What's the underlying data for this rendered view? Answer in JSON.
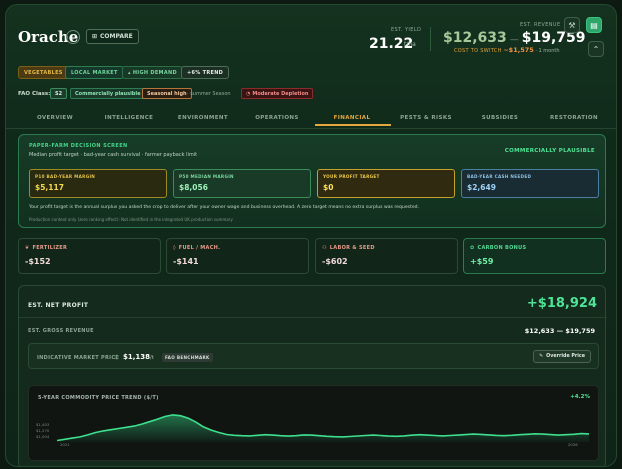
{
  "crop": {
    "name": "Orache",
    "compare_label": "COMPARE"
  },
  "header": {
    "yield_label": "EST. YIELD",
    "yield_value": "21.22",
    "yield_unit": "t/ha",
    "revenue_label": "EST. REVENUE",
    "revenue_low": "$12,633",
    "revenue_sep": "—",
    "revenue_high": "$19,759",
    "cost_label": "COST TO SWITCH",
    "cost_value": "~$1,575",
    "cost_suffix": "· 1 month"
  },
  "tags": [
    "VEGETABLES",
    "LOCAL MARKET",
    "HIGH DEMAND",
    "+6% TREND"
  ],
  "fao": {
    "label": "FAO Class:",
    "class_code": "S2",
    "class_name": "Commercially plausible",
    "seasonal": "Seasonal high",
    "season_note": "summer Season",
    "depletion": "Moderate Depletion"
  },
  "tabs": [
    "OVERVIEW",
    "INTELLIGENCE",
    "ENVIRONMENT",
    "OPERATIONS",
    "FINANCIAL",
    "PESTS & RISKS",
    "SUBSIDIES",
    "RESTORATION"
  ],
  "active_tab": "FINANCIAL",
  "screen": {
    "title": "PAPER-FARM DECISION SCREEN",
    "subtitle": "Median profit target · bad-year cash survival · farmer payback limit",
    "status": "COMMERCIALLY PLAUSIBLE",
    "metrics": [
      {
        "label": "P10 BAD-YEAR MARGIN",
        "value": "$5,117"
      },
      {
        "label": "P50 MEDIAN MARGIN",
        "value": "$8,056"
      },
      {
        "label": "YOUR PROFIT TARGET",
        "value": "$0"
      },
      {
        "label": "BAD-YEAR CASH NEEDED",
        "value": "$2,649"
      }
    ],
    "description": "Your profit target is the annual surplus you asked the crop to deliver after your owner wage and business overhead. A zero target means no extra surplus was requested.",
    "footnote": "Production context only (zero ranking effect): Not identified in the integrated UK production summary"
  },
  "costs": [
    {
      "label": "FERTILIZER",
      "value": "-$152",
      "icon": "leaf-icon"
    },
    {
      "label": "FUEL / MACH.",
      "value": "-$141",
      "icon": "fuel-icon"
    },
    {
      "label": "LABOR & SEED",
      "value": "-$602",
      "icon": "people-icon"
    },
    {
      "label": "CARBON BONUS",
      "value": "+$59",
      "icon": "carbon-icon"
    }
  ],
  "profit": {
    "net_label": "EST. NET PROFIT",
    "net_value": "+$18,924",
    "gross_label": "EST. GROSS REVENUE",
    "gross_value": "$12,633 — $19,759",
    "market_label": "INDICATIVE MARKET PRICE",
    "market_value": "$1,138",
    "market_unit": "/t",
    "benchmark": "FAO BENCHMARK",
    "override_label": "Override Price"
  },
  "trend": {
    "title": "5-YEAR COMMODITY PRICE TREND ($/T)",
    "change": "+4.2%",
    "y_ticks": [
      "$1,403",
      "$1,270",
      "$1,004"
    ],
    "x_start": "2021",
    "x_end": "2026"
  },
  "chart_data": {
    "type": "area",
    "title": "5-YEAR COMMODITY PRICE TREND ($/T)",
    "xlabel": "",
    "ylabel": "",
    "x_range": [
      "2021",
      "2026"
    ],
    "ylim": [
      1004,
      1403
    ],
    "y_ticks": [
      1403,
      1270,
      1004
    ],
    "series": [
      {
        "values": [
          1010,
          1025,
          1040,
          1055,
          1080,
          1110,
          1130,
          1145,
          1160,
          1175,
          1190,
          1215,
          1245,
          1275,
          1310,
          1330,
          1320,
          1290,
          1240,
          1180,
          1140,
          1110,
          1085,
          1075,
          1070,
          1068,
          1075,
          1082,
          1078,
          1070,
          1065,
          1070,
          1080,
          1077,
          1070,
          1062,
          1058,
          1055,
          1060,
          1066,
          1072,
          1078,
          1072,
          1065,
          1062,
          1068,
          1076,
          1082,
          1078,
          1072,
          1068,
          1072,
          1078,
          1084,
          1090,
          1086,
          1080,
          1074,
          1070,
          1075,
          1082,
          1088,
          1094,
          1090,
          1084,
          1078,
          1082,
          1088,
          1096,
          1092
        ]
      }
    ]
  }
}
